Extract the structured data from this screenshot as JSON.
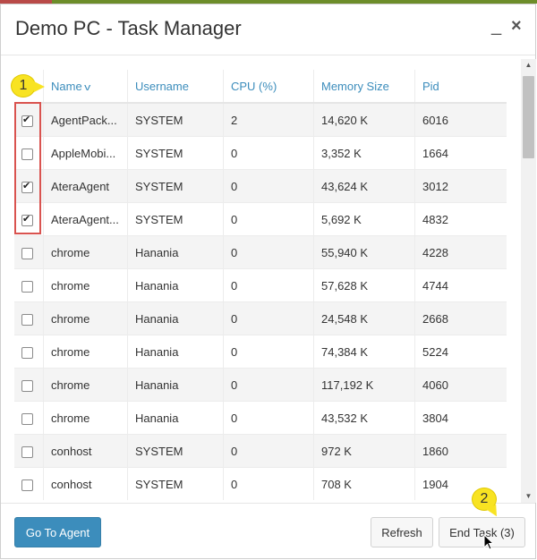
{
  "window": {
    "title": "Demo PC - Task Manager",
    "minimize_icon": "minimize-icon",
    "close_icon": "close-icon"
  },
  "table": {
    "columns": [
      "Name",
      "Username",
      "CPU (%)",
      "Memory Size",
      "Pid"
    ],
    "sorted_by": "Name",
    "rows": [
      {
        "checked": true,
        "name": "AgentPack...",
        "username": "SYSTEM",
        "cpu": "2",
        "memory": "14,620 K",
        "pid": "6016"
      },
      {
        "checked": false,
        "name": "AppleMobi...",
        "username": "SYSTEM",
        "cpu": "0",
        "memory": "3,352 K",
        "pid": "1664"
      },
      {
        "checked": true,
        "name": "AteraAgent",
        "username": "SYSTEM",
        "cpu": "0",
        "memory": "43,624 K",
        "pid": "3012"
      },
      {
        "checked": true,
        "name": "AteraAgent...",
        "username": "SYSTEM",
        "cpu": "0",
        "memory": "5,692 K",
        "pid": "4832"
      },
      {
        "checked": false,
        "name": "chrome",
        "username": "Hanania",
        "cpu": "0",
        "memory": "55,940 K",
        "pid": "4228"
      },
      {
        "checked": false,
        "name": "chrome",
        "username": "Hanania",
        "cpu": "0",
        "memory": "57,628 K",
        "pid": "4744"
      },
      {
        "checked": false,
        "name": "chrome",
        "username": "Hanania",
        "cpu": "0",
        "memory": "24,548 K",
        "pid": "2668"
      },
      {
        "checked": false,
        "name": "chrome",
        "username": "Hanania",
        "cpu": "0",
        "memory": "74,384 K",
        "pid": "5224"
      },
      {
        "checked": false,
        "name": "chrome",
        "username": "Hanania",
        "cpu": "0",
        "memory": "117,192 K",
        "pid": "4060"
      },
      {
        "checked": false,
        "name": "chrome",
        "username": "Hanania",
        "cpu": "0",
        "memory": "43,532 K",
        "pid": "3804"
      },
      {
        "checked": false,
        "name": "conhost",
        "username": "SYSTEM",
        "cpu": "0",
        "memory": "972 K",
        "pid": "1860"
      },
      {
        "checked": false,
        "name": "conhost",
        "username": "SYSTEM",
        "cpu": "0",
        "memory": "708 K",
        "pid": "1904"
      }
    ]
  },
  "footer": {
    "go_to_agent": "Go To Agent",
    "refresh": "Refresh",
    "end_task": "End Task (3)"
  },
  "annotations": {
    "callout_1": "1",
    "callout_2": "2"
  },
  "colors": {
    "accent": "#3c8dbc",
    "highlight": "#d9534f",
    "callout": "#f8e322"
  }
}
